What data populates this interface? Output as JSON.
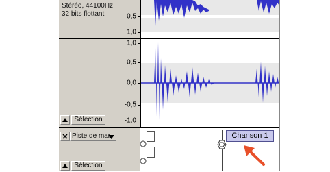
{
  "audio_track": {
    "format_line": "Stéréo, 44100Hz",
    "sample_line": "32 bits flottant",
    "select_button": "Sélection",
    "ruler_top": [
      "-0,5",
      "-1,0"
    ],
    "ruler_bottom": [
      "1,0",
      "0,5",
      "0,0",
      "-0,5",
      "-1,0"
    ]
  },
  "label_track": {
    "name": "Piste de mar",
    "select_button": "Sélection",
    "label_text": "Chanson 1"
  },
  "colors": {
    "waveform": "#3232c8",
    "label_fill": "#c8c8ec",
    "arrow": "#e8502a"
  }
}
